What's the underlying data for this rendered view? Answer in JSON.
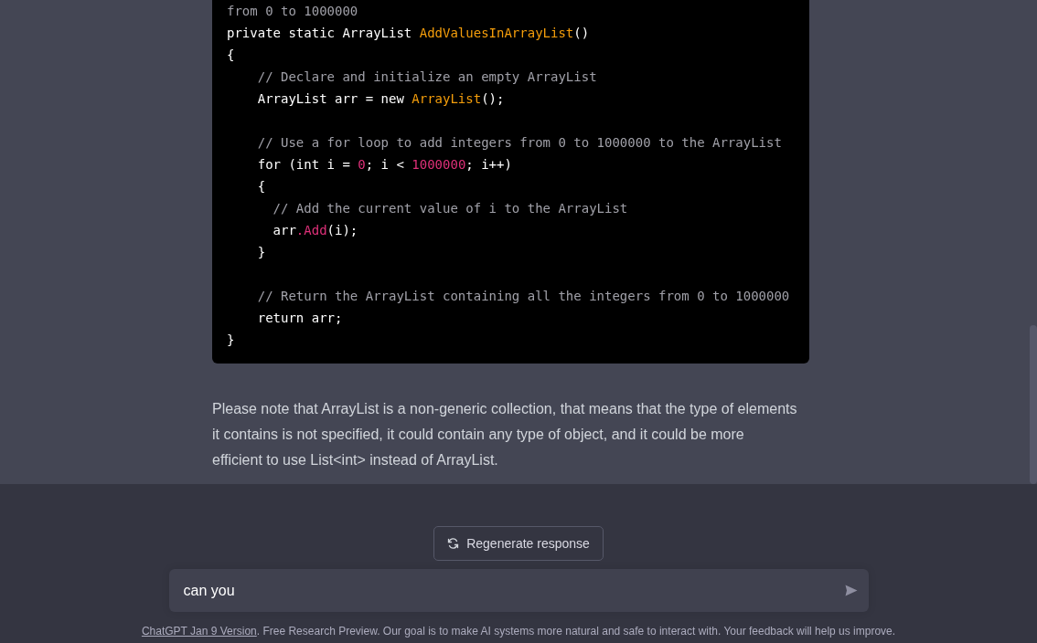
{
  "code_block": {
    "lines": [
      [
        {
          "kind": "comment",
          "text": "from 0 to 1000000"
        }
      ],
      [
        {
          "kind": "plain",
          "text": "private static ArrayList "
        },
        {
          "kind": "func",
          "text": "AddValuesInArrayList"
        },
        {
          "kind": "plain",
          "text": "()"
        }
      ],
      [
        {
          "kind": "plain",
          "text": "{"
        }
      ],
      [
        {
          "kind": "comment",
          "text": "    // Declare and initialize an empty ArrayList"
        }
      ],
      [
        {
          "kind": "plain",
          "text": "    ArrayList arr = new "
        },
        {
          "kind": "func",
          "text": "ArrayList"
        },
        {
          "kind": "plain",
          "text": "();"
        }
      ],
      {
        "kind": "blank"
      },
      [
        {
          "kind": "comment",
          "text": "    // Use a for loop to add integers from 0 to 1000000 to the ArrayList"
        }
      ],
      [
        {
          "kind": "plain",
          "text": "    for (int i = "
        },
        {
          "kind": "number",
          "text": "0"
        },
        {
          "kind": "plain",
          "text": "; i < "
        },
        {
          "kind": "number",
          "text": "1000000"
        },
        {
          "kind": "plain",
          "text": "; i++)"
        }
      ],
      [
        {
          "kind": "plain",
          "text": "    {"
        }
      ],
      [
        {
          "kind": "comment",
          "text": "      // Add the current value of i to the ArrayList"
        }
      ],
      [
        {
          "kind": "plain",
          "text": "      arr"
        },
        {
          "kind": "number",
          "text": ".Add"
        },
        {
          "kind": "plain",
          "text": "(i);"
        }
      ],
      [
        {
          "kind": "plain",
          "text": "    }"
        }
      ],
      {
        "kind": "blank"
      },
      [
        {
          "kind": "comment",
          "text": "    // Return the ArrayList containing all the integers from 0 to 1000000"
        }
      ],
      [
        {
          "kind": "plain",
          "text": "    return arr;"
        }
      ],
      [
        {
          "kind": "plain",
          "text": "}"
        }
      ]
    ]
  },
  "message": "Please note that ArrayList is a non-generic collection, that means that the type of elements it contains is not specified, it could contain any type of object, and it could be more efficient to use List<int> instead of ArrayList.",
  "regenerate_button": "Regenerate response",
  "prompt_input": {
    "value": "can you"
  },
  "footer": {
    "link": "ChatGPT Jan 9 Version",
    "text": ". Free Research Preview. Our goal is to make AI systems more natural and safe to interact with. Your feedback will help us improve."
  }
}
